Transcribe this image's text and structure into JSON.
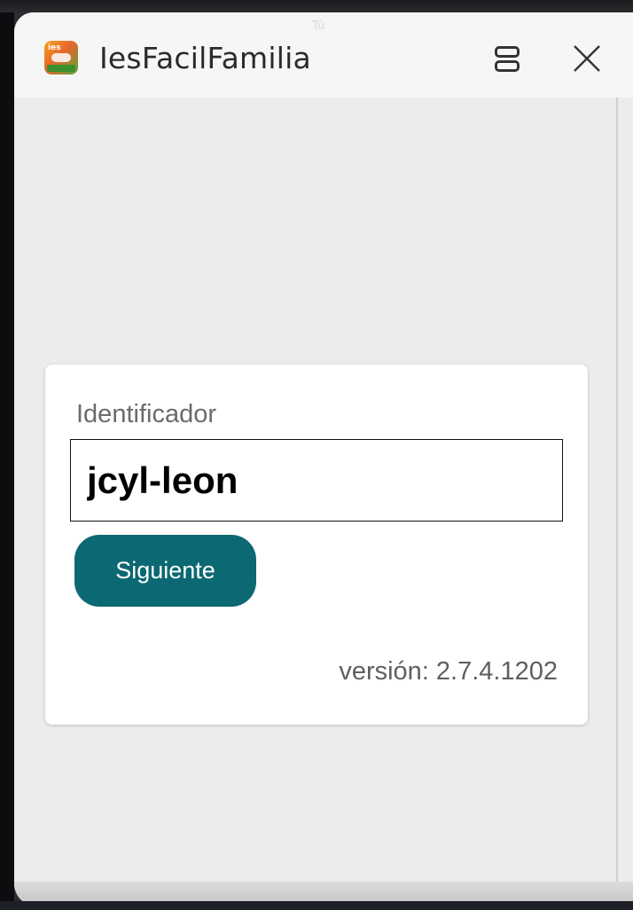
{
  "overlay": {
    "top_label": "Tú"
  },
  "window": {
    "app_icon": {
      "name": "iesfacil-familia-logo-icon",
      "text": "ies fácil familia"
    },
    "title": "IesFacilFamilia",
    "split_icon": "split-view-icon",
    "close_icon": "close-icon"
  },
  "login": {
    "label": "Identificador",
    "input_value": "jcyl-leon",
    "next_button": "Siguiente",
    "version": "versión: 2.7.4.1202"
  },
  "colors": {
    "accent": "#0c6872",
    "background": "#ececec",
    "card": "#ffffff"
  }
}
